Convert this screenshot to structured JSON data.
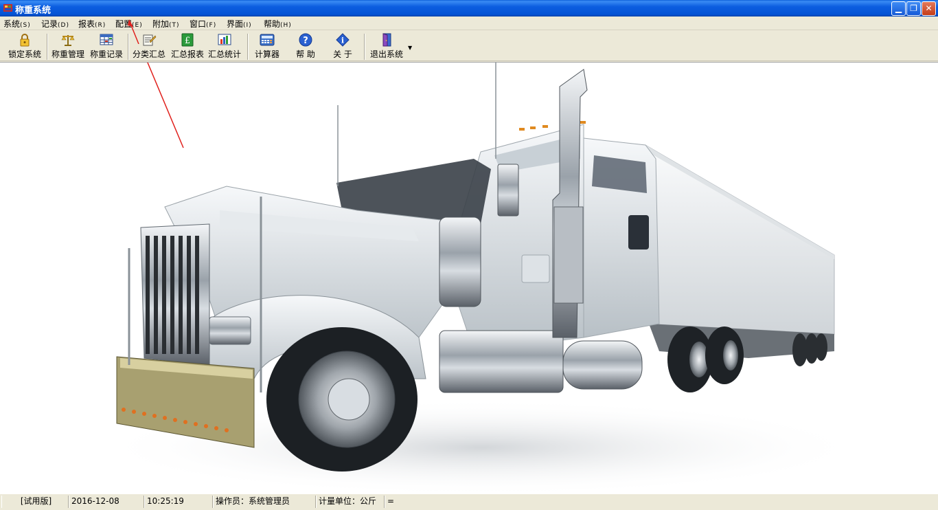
{
  "window": {
    "title": "称重系统"
  },
  "menu": [
    {
      "label": "系统",
      "accel": "(S)"
    },
    {
      "label": "记录",
      "accel": "(D)"
    },
    {
      "label": "报表",
      "accel": "(R)"
    },
    {
      "label": "配置",
      "accel": "(E)"
    },
    {
      "label": "附加",
      "accel": "(T)"
    },
    {
      "label": "窗口",
      "accel": "(F)"
    },
    {
      "label": "界面",
      "accel": "(I)"
    },
    {
      "label": "帮助",
      "accel": "(H)"
    }
  ],
  "toolbar": [
    {
      "label": "锁定系统",
      "icon": "lock-icon"
    },
    {
      "label": "称重管理",
      "icon": "scale-icon"
    },
    {
      "label": "称重记录",
      "icon": "record-grid-icon"
    },
    {
      "label": "分类汇总",
      "icon": "category-summary-icon"
    },
    {
      "label": "汇总报表",
      "icon": "pound-report-icon"
    },
    {
      "label": "汇总统计",
      "icon": "statistics-chart-icon"
    },
    {
      "label": "计算器",
      "icon": "calculator-icon"
    },
    {
      "label": "帮 助",
      "icon": "help-icon"
    },
    {
      "label": "关 于",
      "icon": "info-icon"
    },
    {
      "label": "退出系统",
      "icon": "exit-door-icon"
    }
  ],
  "statusbar": {
    "version": "[试用版]",
    "date": "2016-12-08",
    "time": "10:25:19",
    "operator": "操作员：系统管理员",
    "unit": "计量单位：公斤",
    "extra": "="
  },
  "colors": {
    "titlebar": "#0453d4",
    "annotation_arrow": "#e0201c"
  }
}
